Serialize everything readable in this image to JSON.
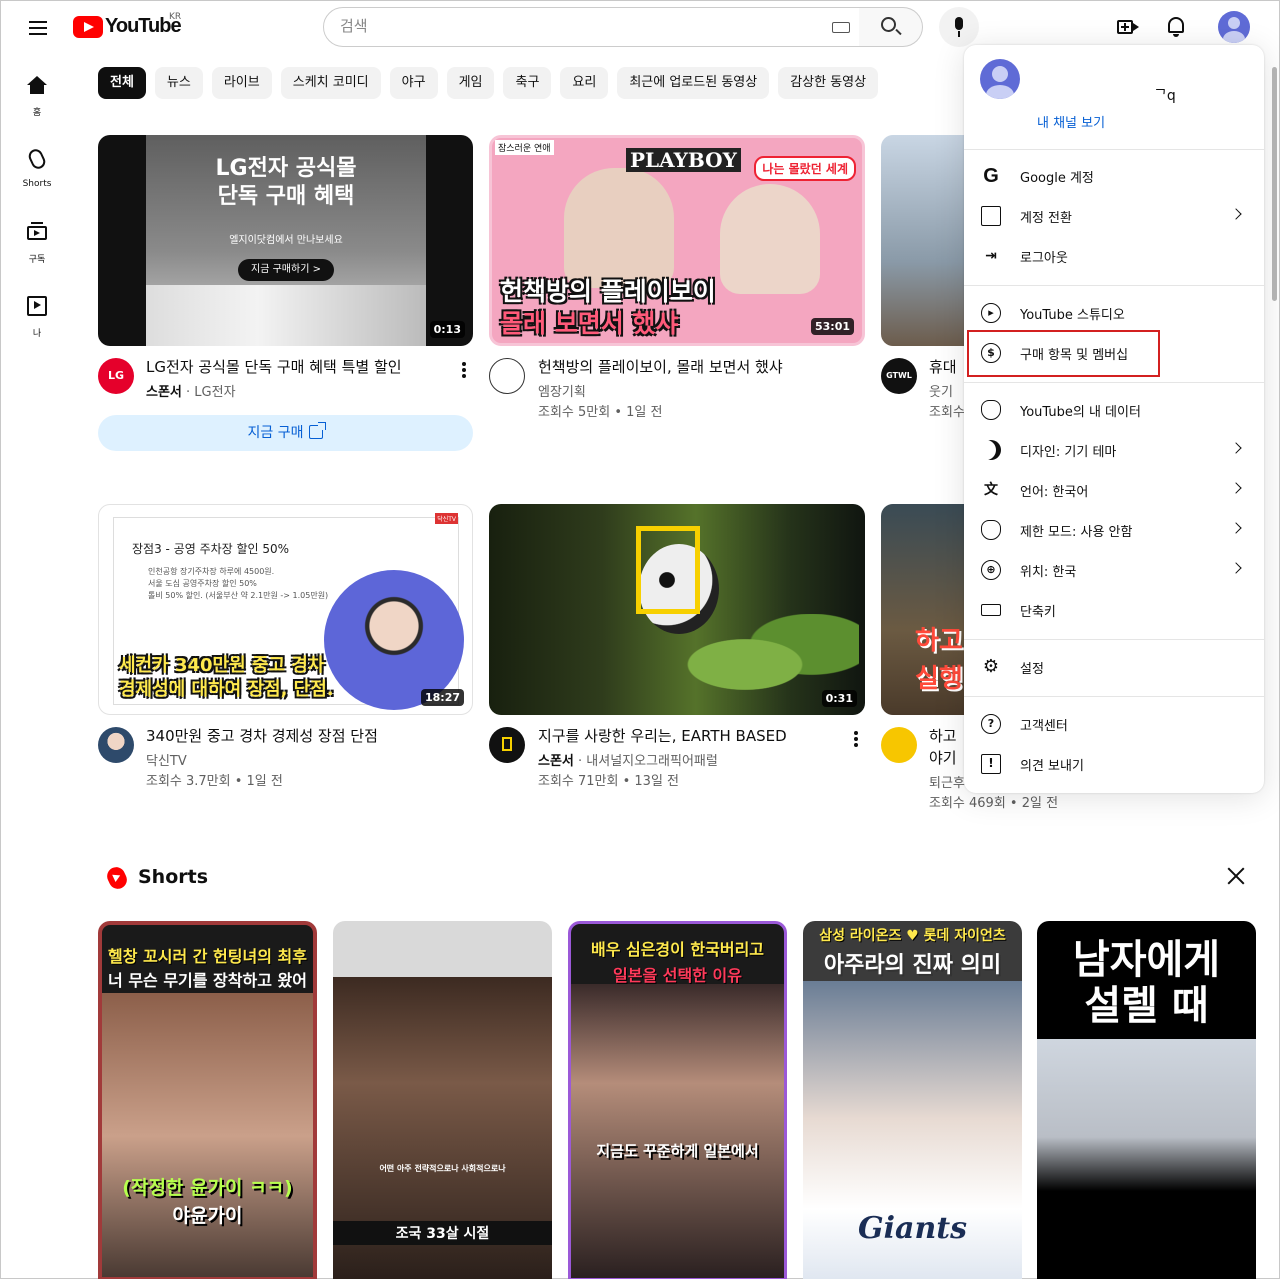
{
  "header": {
    "logo_text": "YouTube",
    "region": "KR",
    "search_placeholder": "검색"
  },
  "sidebar": {
    "items": [
      {
        "label": "홈"
      },
      {
        "label": "Shorts"
      },
      {
        "label": "구독"
      },
      {
        "label": "나"
      }
    ]
  },
  "chips": [
    "전체",
    "뉴스",
    "라이브",
    "스케치 코미디",
    "야구",
    "게임",
    "축구",
    "요리",
    "최근에 업로드된 동영상",
    "감상한 동영상"
  ],
  "videos": [
    {
      "thumb_lines": [
        "LG전자 공식몰",
        "단독 구매 혜택"
      ],
      "thumb_sub": "엘지이닷컴에서 만나보세요",
      "thumb_btn": "지금 구매하기 >",
      "duration": "0:13",
      "title": "LG전자 공식몰 단독 구매 혜택 특별 할인",
      "sponsor": "스폰서",
      "channel": "LG전자",
      "cta": "지금 구매",
      "avatar": "LG"
    },
    {
      "thumb_tag": "잠스러운 연애",
      "thumb_brand": "PLAYBOY",
      "thumb_bubble": "나는 몰랐던 세계",
      "thumb_cap1": "헌책방의 플레이보이",
      "thumb_cap2": "몰래 보면서 했샤",
      "duration": "53:01",
      "title": "헌책방의 플레이보이, 몰래 보면서 했샤",
      "channel": "엠장기획",
      "stats": "조회수 5만회 • 1일 전"
    },
    {
      "title": "휴대",
      "channel": "웃기",
      "stats": "조회수",
      "avatar": "GTWL"
    },
    {
      "slide_title": "장점3 - 공영 주차장 할인 50%",
      "slide_lines": [
        "인천공항 장기주차장 하루에 4500원.",
        "서울 도심 공영주차장 할인 50%",
        "톨비 50% 할인. (서울부산 약 2.1만원 -> 1.05만원)"
      ],
      "thumb_cap1": "세컨카 340만원 중고 경차",
      "thumb_cap2": "경제성에 대하여 장점, 단점.",
      "badge": "닥신TV",
      "duration": "18:27",
      "title": "340만원 중고 경차 경제성 장점 단점",
      "channel": "닥신TV",
      "stats": "조회수 3.7만회 • 1일 전"
    },
    {
      "duration": "0:31",
      "title": "지구를 사랑한 우리는, EARTH BASED",
      "sponsor": "스폰서",
      "channel": "내셔널지오그래픽어패럴",
      "stats": "조회수 71만회 • 13일 전"
    },
    {
      "thumb_cap": "하고 실행",
      "title_l1": "하고",
      "title_l2": "야기",
      "channel": "퇴근후",
      "stats": "조회수 469회 • 2일 전"
    }
  ],
  "shorts": {
    "title": "Shorts",
    "items": [
      {
        "lines": [
          "헬창 꼬시러 간 헌팅녀의 최후",
          "너 무슨 무기를 장착하고 왔어",
          "(작정한 윤가이 ㅋㅋ)",
          "야윤가이"
        ]
      },
      {
        "lines": [
          "어떤 아주 전략적으로나 사회적으로나",
          "조국 33살 시절"
        ]
      },
      {
        "lines": [
          "배우 심은경이 한국버리고",
          "일본을 선택한 이유",
          "지금도 꾸준하게 일본에서"
        ]
      },
      {
        "lines": [
          "삼성 라이온즈 ♥ 롯데 자이언츠",
          "아주라의 진짜 의미",
          "Giants"
        ]
      },
      {
        "lines": [
          "남자에게",
          "설렐 때"
        ]
      }
    ]
  },
  "account_menu": {
    "handle": "ᄀq",
    "channel_link": "내 채널 보기",
    "items": [
      {
        "label": "Google 계정",
        "icon": "google-icon",
        "arrow": false
      },
      {
        "label": "계정 전환",
        "icon": "switch-account-icon",
        "arrow": true
      },
      {
        "label": "로그아웃",
        "icon": "sign-out-icon",
        "arrow": false
      },
      {
        "label": "YouTube 스튜디오",
        "icon": "studio-icon",
        "arrow": false
      },
      {
        "label": "구매 항목 및 멤버십",
        "icon": "dollar-icon",
        "arrow": false
      },
      {
        "label": "YouTube의 내 데이터",
        "icon": "shield-icon",
        "arrow": false
      },
      {
        "label": "디자인: 기기 테마",
        "icon": "moon-icon",
        "arrow": true
      },
      {
        "label": "언어: 한국어",
        "icon": "translate-icon",
        "arrow": true
      },
      {
        "label": "제한 모드: 사용 안함",
        "icon": "restricted-icon",
        "arrow": true
      },
      {
        "label": "위치: 한국",
        "icon": "globe-icon",
        "arrow": true
      },
      {
        "label": "단축키",
        "icon": "keyboard-icon",
        "arrow": false
      },
      {
        "label": "설정",
        "icon": "gear-icon",
        "arrow": false
      },
      {
        "label": "고객센터",
        "icon": "help-icon",
        "arrow": false
      },
      {
        "label": "의견 보내기",
        "icon": "feedback-icon",
        "arrow": false
      }
    ]
  },
  "colors": {
    "brand": "#ff0000",
    "link": "#065fd4",
    "highlight": "#d32020"
  }
}
